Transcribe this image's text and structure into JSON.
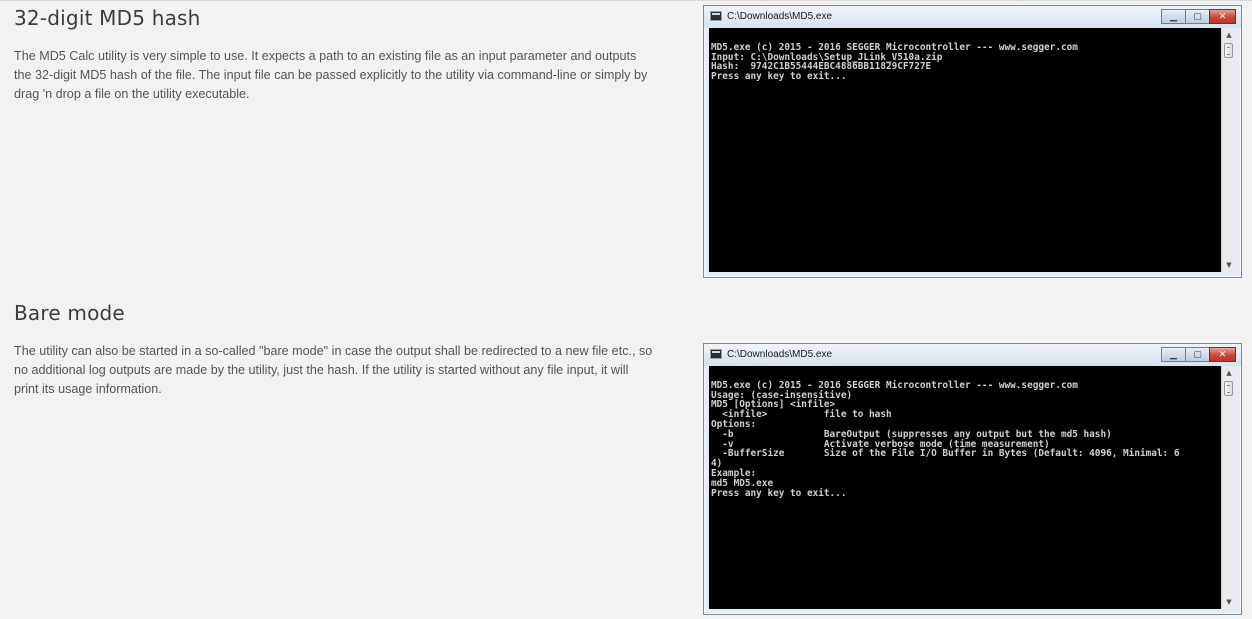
{
  "sections": [
    {
      "title": "32-digit MD5 hash",
      "text": "The MD5 Calc utility is very simple to use. It expects a path to an existing file as an input parameter and outputs the 32-digit MD5 hash of the file. The input file can be passed explicitly to the utility via command-line or simply by drag 'n drop a file on the utility executable.",
      "window": {
        "title": "C:\\Downloads\\MD5.exe",
        "console": "\nMD5.exe (c) 2015 - 2016 SEGGER Microcontroller --- www.segger.com\nInput: C:\\Downloads\\Setup_JLink_V510a.zip\nHash:  9742C1B55444EBC4886BB11829CF727E\nPress any key to exit..."
      }
    },
    {
      "title": "Bare mode",
      "text": "The utility can also be started in a so-called \"bare mode\" in case the output shall be redirected to a new file etc., so no additional log outputs are made by the utility, just the hash. If the utility is started without any file input, it will print its usage information.",
      "window": {
        "title": "C:\\Downloads\\MD5.exe",
        "console": "\nMD5.exe (c) 2015 - 2016 SEGGER Microcontroller --- www.segger.com\nUsage: (case-insensitive)\nMD5 [Options] <infile>\n  <infile>          file to hash\nOptions:\n  -b                BareOutput (suppresses any output but the md5 hash)\n  -v                Activate verbose mode (time measurement)\n  -BufferSize       Size of the File I/O Buffer in Bytes (Default: 4096, Minimal: 6\n4)\nExample:\nmd5 MD5.exe\nPress any key to exit..."
      }
    }
  ],
  "window_controls": {
    "minimize": "▁",
    "maximize": "▢",
    "close": "✕"
  },
  "scrollbar": {
    "up": "▲",
    "down": "▼"
  }
}
